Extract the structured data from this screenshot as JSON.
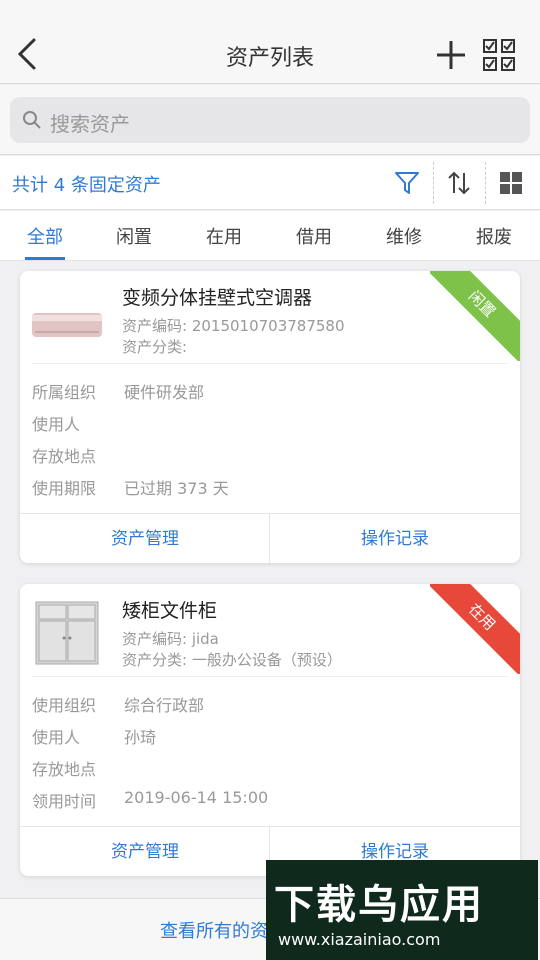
{
  "header": {
    "title": "资产列表",
    "back_icon": "chevron-left-icon",
    "add_icon": "plus-icon",
    "multi_select_icon": "checklist-icon"
  },
  "search": {
    "placeholder": "搜索资产"
  },
  "toolbar": {
    "count_text": "共计 4 条固定资产",
    "filter_icon": "filter-icon",
    "sort_icon": "sort-icon",
    "grid_icon": "grid-icon"
  },
  "tabs": [
    {
      "label": "全部",
      "active": true
    },
    {
      "label": "闲置"
    },
    {
      "label": "在用"
    },
    {
      "label": "借用"
    },
    {
      "label": "维修"
    },
    {
      "label": "报废"
    }
  ],
  "cards": [
    {
      "name": "变频分体挂壁式空调器",
      "code": "资产编码: 2015010703787580",
      "category": "资产分类:",
      "status": "闲置",
      "status_color": "#7fc24a",
      "rows": [
        {
          "label": "所属组织",
          "value": "硬件研发部"
        },
        {
          "label": "使用人",
          "value": ""
        },
        {
          "label": "存放地点",
          "value": ""
        },
        {
          "label": "使用期限",
          "value": "已过期 373 天"
        }
      ],
      "manage_label": "资产管理",
      "log_label": "操作记录"
    },
    {
      "name": "矮柜文件柜",
      "code": "资产编码: jida",
      "category": "资产分类: 一般办公设备（预设）",
      "status": "在用",
      "status_color": "#e8483a",
      "rows": [
        {
          "label": "使用组织",
          "value": "综合行政部"
        },
        {
          "label": "使用人",
          "value": "孙琦"
        },
        {
          "label": "存放地点",
          "value": ""
        },
        {
          "label": "领用时间",
          "value": "2019-06-14 15:00"
        }
      ],
      "manage_label": "资产管理",
      "log_label": "操作记录"
    }
  ],
  "bottom": {
    "text": "查看所有的资产"
  },
  "watermark": {
    "title": "下载乌应用",
    "url": "www.xiazainiao.com"
  }
}
